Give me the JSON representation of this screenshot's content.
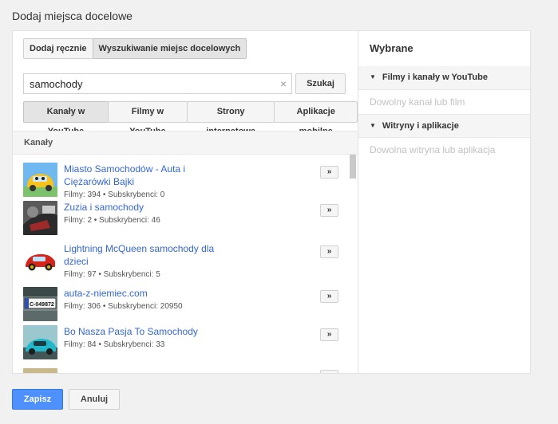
{
  "page": {
    "title": "Dodaj miejsca docelowe"
  },
  "mode_tabs": [
    {
      "label": "Dodaj ręcznie",
      "active": false
    },
    {
      "label": "Wyszukiwanie miejsc docelowych",
      "active": true
    }
  ],
  "search": {
    "value": "samochody",
    "placeholder": "",
    "button_label": "Szukaj",
    "clear_icon": "×"
  },
  "type_tabs": [
    {
      "label": "Kanały w YouTube",
      "active": true
    },
    {
      "label": "Filmy w YouTube",
      "active": false
    },
    {
      "label": "Strony internetowe",
      "active": false
    },
    {
      "label": "Aplikacje mobilne",
      "active": false
    }
  ],
  "results": {
    "header": "Kanały",
    "add_label": "»",
    "items": [
      {
        "name_line1": "Miasto Samochodów - Auta i",
        "name_line2": "Ciężarówki Bajki",
        "meta": "Filmy: 394 • Subskrybenci: 0",
        "thumb": "yellow-cartoon-car"
      },
      {
        "name_line1": "Zuzia i samochody",
        "name_line2": "",
        "meta": "Filmy: 2 • Subskrybenci: 46",
        "thumb": "car-interior"
      },
      {
        "name_line1": "Lightning McQueen samochody dla",
        "name_line2": "dzieci",
        "meta": "Filmy: 97 • Subskrybenci: 5",
        "thumb": "red-cartoon-car"
      },
      {
        "name_line1": "auta-z-niemiec.com",
        "name_line2": "",
        "meta": "Filmy: 306 • Subskrybenci: 20950",
        "thumb": "license-plate"
      },
      {
        "name_line1": "Bo Nasza Pasja To Samochody",
        "name_line2": "",
        "meta": "Filmy: 84 • Subskrybenci: 33",
        "thumb": "cyan-sports-car"
      }
    ],
    "plate_text": "C-049872"
  },
  "selected": {
    "title": "Wybrane",
    "groups": [
      {
        "label": "Filmy i kanały w YouTube",
        "empty": "Dowolny kanał lub film"
      },
      {
        "label": "Witryny i aplikacje",
        "empty": "Dowolna witryna lub aplikacja"
      }
    ]
  },
  "footer": {
    "save_label": "Zapisz",
    "cancel_label": "Anuluj"
  },
  "colors": {
    "link": "#3367d6",
    "primary": "#4d90fe"
  }
}
